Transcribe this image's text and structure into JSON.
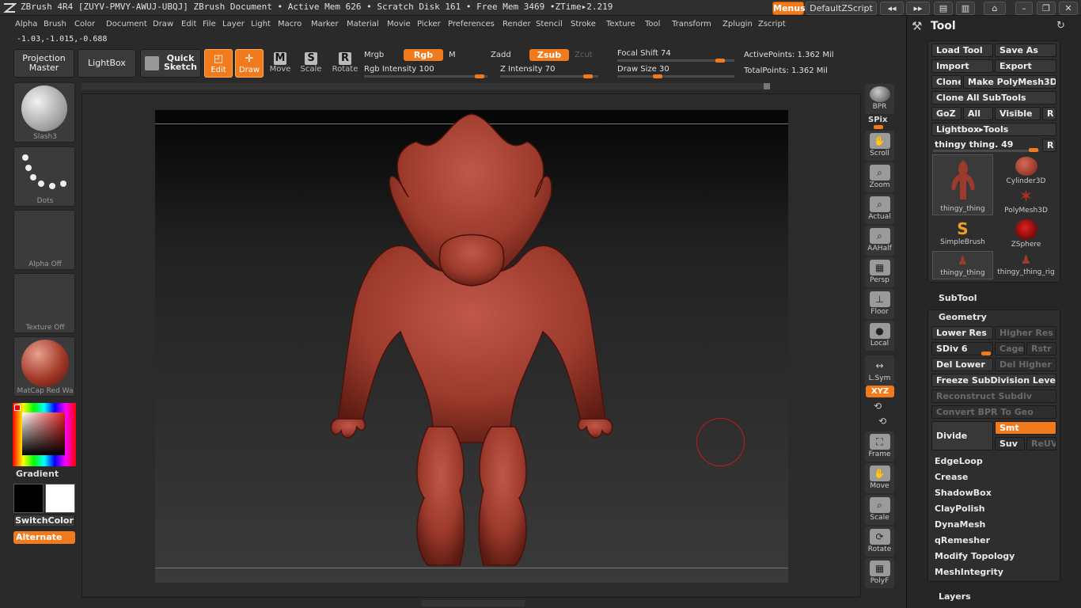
{
  "titlebar": {
    "text": "ZBrush 4R4 [ZUYV-PMVY-AWUJ-UBQJ]    ZBrush Document     • Active Mem 626 • Scratch Disk 161 • Free Mem 3469 •ZTime▸2.219",
    "menus_btn": "Menus",
    "script_btn": "DefaultZScript"
  },
  "menubar": [
    "Alpha",
    "Brush",
    "Color",
    "Document",
    "Draw",
    "Edit",
    "File",
    "Layer",
    "Light",
    "Macro",
    "Marker",
    "Material",
    "Movie",
    "Picker",
    "Preferences",
    "Render",
    "Stencil",
    "Stroke",
    "Texture",
    "Tool",
    "Transform",
    "Zplugin",
    "Zscript"
  ],
  "coords": "-1.03,-1.015,-0.688",
  "topshelf": {
    "projection_master": "Projection Master",
    "lightbox": "LightBox",
    "quick_sketch": "Quick Sketch",
    "edit": "Edit",
    "draw": "Draw",
    "move": "Move",
    "scale": "Scale",
    "rotate": "Rotate",
    "mrgb": "Mrgb",
    "rgb": "Rgb",
    "m": "M",
    "zadd": "Zadd",
    "zsub": "Zsub",
    "zcut": "Zcut",
    "rgb_intensity": "Rgb Intensity 100",
    "rgb_intensity_value": 100,
    "z_intensity": "Z Intensity 70",
    "z_intensity_value": 70,
    "focal_shift": "Focal Shift 74",
    "focal_shift_value": 74,
    "draw_size": "Draw Size 30",
    "draw_size_value": 30,
    "active_points": "ActivePoints: 1.362 Mil",
    "total_points": "TotalPoints: 1.362 Mil"
  },
  "leftshelf": {
    "brush": "Slash3",
    "stroke": "Dots",
    "alpha": "Alpha Off",
    "texture": "Texture Off",
    "material": "MatCap Red Wa",
    "gradient": "Gradient",
    "switch_color": "SwitchColor",
    "alternate": "Alternate"
  },
  "rightrail": [
    "BPR",
    "SPix",
    "Scroll",
    "Zoom",
    "Actual",
    "AAHalf",
    "Persp",
    "Floor",
    "Local",
    "L.Sym",
    "XYZ",
    "Frame",
    "Move",
    "Scale",
    "Rotate",
    "PolyF"
  ],
  "palette": {
    "title": "Tool",
    "load_tool": "Load Tool",
    "save_as": "Save As",
    "import": "Import",
    "export": "Export",
    "clone": "Clone",
    "make_polymesh": "Make PolyMesh3D",
    "clone_all": "Clone All SubTools",
    "goz": "GoZ",
    "all": "All",
    "visible": "Visible",
    "r": "R",
    "lightbox_tools": "Lightbox▸Tools",
    "current_tool": "thingy thing. 49",
    "thumbs": [
      "thingy_thing",
      "Cylinder3D",
      "PolyMesh3D",
      "SimpleBrush",
      "ZSphere",
      "thingy_thing",
      "thingy_thing_rig"
    ],
    "subtool": "SubTool",
    "geometry": "Geometry",
    "lower_res": "Lower Res",
    "higher_res": "Higher Res",
    "sdiv": "SDiv 6",
    "sdiv_value": 6,
    "cage": "Cage",
    "rstr": "Rstr",
    "del_lower": "Del Lower",
    "del_higher": "Del Higher",
    "freeze": "Freeze SubDivision Levels",
    "reconstruct": "Reconstruct Subdiv",
    "convert_bpr": "Convert BPR To Geo",
    "divide": "Divide",
    "smt": "Smt",
    "suv": "Suv",
    "reuv": "ReUV",
    "sections": [
      "EdgeLoop",
      "Crease",
      "ShadowBox",
      "ClayPolish",
      "DynaMesh",
      "qRemesher",
      "Modify Topology",
      "MeshIntegrity"
    ],
    "layers": "Layers"
  },
  "colors": {
    "accent": "#f07a1c",
    "model": "#9c3a2c"
  }
}
